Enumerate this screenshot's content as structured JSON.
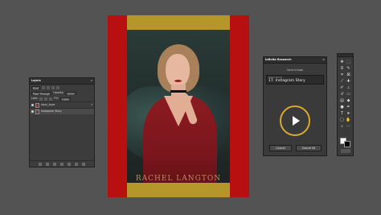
{
  "layers_panel": {
    "tab": "Layers",
    "menu_glyph": "≡",
    "filter_label": "Kind",
    "blend_mode": "Pass Through",
    "opacity_label": "Opacity:",
    "opacity_value": "100%",
    "lock_label": "Lock:",
    "fill_label": "Fill:",
    "fill_value": "100%",
    "layers": [
      {
        "name": "story_layer",
        "selected": false
      },
      {
        "name": "Instagram Story",
        "selected": true
      }
    ]
  },
  "canvas": {
    "watermark": "RACHEL LANGTON",
    "colors": {
      "red": "#b80f11",
      "gold": "#b4962a"
    }
  },
  "infinite_research": {
    "title": "Infinite Research",
    "close_glyph": "≡",
    "section_label": "Save Image",
    "field_label": "Batch Name",
    "field_value": "17. Instagram Story",
    "play_icon": "play-icon",
    "cancel_label": "Cancel",
    "cancel_all_label": "Cancel All",
    "accent": "#d6aa2e"
  },
  "tools": [
    {
      "name": "move-tool-icon",
      "glyph": "✥"
    },
    {
      "name": "marquee-tool-icon",
      "glyph": "⬚"
    },
    {
      "name": "lasso-tool-icon",
      "glyph": "ᘐ"
    },
    {
      "name": "quick-select-icon",
      "glyph": "✎"
    },
    {
      "name": "crop-tool-icon",
      "glyph": "⌗"
    },
    {
      "name": "frame-tool-icon",
      "glyph": "⊠"
    },
    {
      "name": "eyedropper-icon",
      "glyph": "⁄"
    },
    {
      "name": "healing-brush-icon",
      "glyph": "✚"
    },
    {
      "name": "brush-tool-icon",
      "glyph": "✐"
    },
    {
      "name": "stamp-tool-icon",
      "glyph": "⊥"
    },
    {
      "name": "history-brush-icon",
      "glyph": "↺"
    },
    {
      "name": "eraser-tool-icon",
      "glyph": "▭"
    },
    {
      "name": "gradient-tool-icon",
      "glyph": "▤"
    },
    {
      "name": "blur-tool-icon",
      "glyph": "◆"
    },
    {
      "name": "dodge-tool-icon",
      "glyph": "●"
    },
    {
      "name": "pen-tool-icon",
      "glyph": "✒"
    },
    {
      "name": "type-tool-icon",
      "glyph": "T"
    },
    {
      "name": "path-select-icon",
      "glyph": "➤"
    },
    {
      "name": "rectangle-tool-icon",
      "glyph": "▢"
    },
    {
      "name": "hand-tool-icon",
      "glyph": "✋"
    },
    {
      "name": "zoom-tool-icon",
      "glyph": "⌕"
    },
    {
      "name": "more-tools-icon",
      "glyph": "⋯"
    }
  ]
}
